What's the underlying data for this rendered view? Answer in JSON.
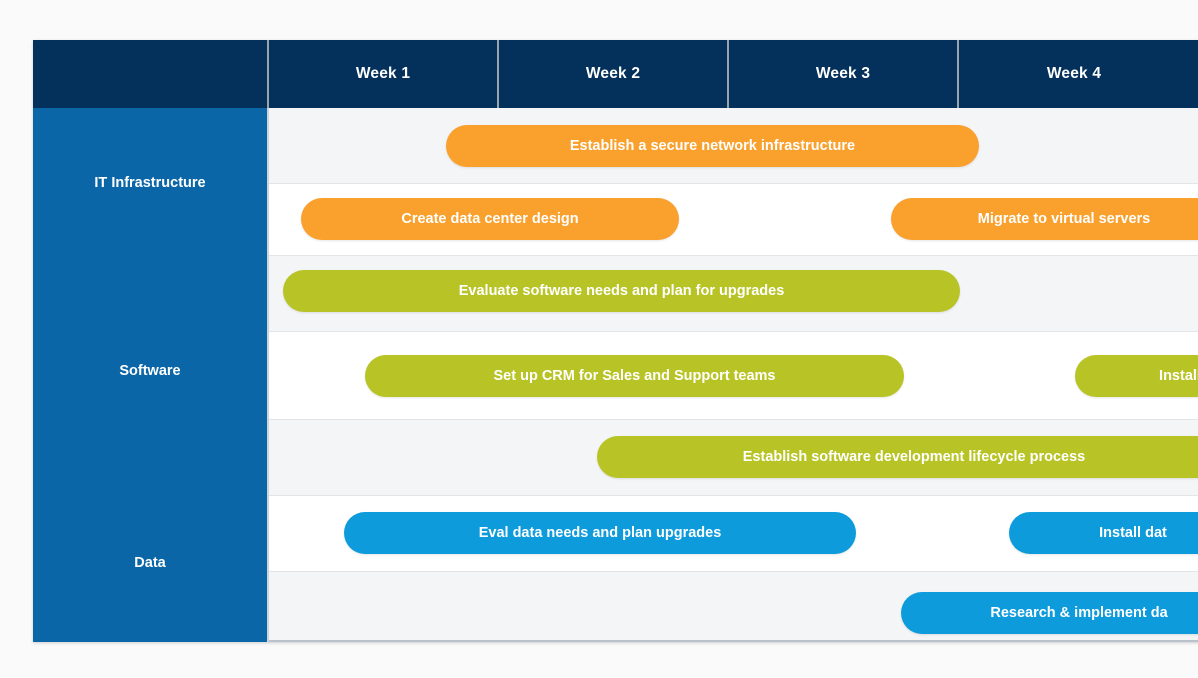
{
  "chart_data": {
    "type": "bar",
    "chart_kind": "gantt",
    "title": "",
    "xlabel": "",
    "ylabel": "",
    "columns": [
      "Week 1",
      "Week 2",
      "Week 3",
      "Week 4"
    ],
    "axis_range_weeks": [
      1,
      5
    ],
    "categories": [
      "IT Infrastructure",
      "Software",
      "Data"
    ],
    "colors": {
      "header_background": "#04305C",
      "category_column": "#0B66A8",
      "row_gray": "#F4F5F6",
      "row_white": "#FFFFFF",
      "orange": "#F9A02D",
      "green": "#B8C425",
      "blue": "#0E9BDC",
      "grid_line": "#E2E4E6",
      "page_background": "#FAFAFA",
      "bar_text": "#FFFFFF"
    },
    "tasks": [
      {
        "label": "Establish a secure network infrastructure",
        "category": "IT Infrastructure",
        "row": 0,
        "color": "#F9A02D",
        "start_week": 1.77,
        "end_week": 4.09,
        "clipped_right": false
      },
      {
        "label": "Create data center design",
        "category": "IT Infrastructure",
        "row": 1,
        "color": "#F9A02D",
        "start_week": 1.14,
        "end_week": 2.78,
        "clipped_right": false
      },
      {
        "label": "Migrate to virtual servers",
        "category": "IT Infrastructure",
        "row": 1,
        "color": "#F9A02D",
        "start_week": 3.7,
        "end_week": 5.2,
        "clipped_right": true
      },
      {
        "label": "Evaluate software needs and plan for upgrades",
        "category": "Software",
        "row": 2,
        "color": "#B8C425",
        "start_week": 1.06,
        "end_week": 4.0,
        "clipped_right": false
      },
      {
        "label": "Set up CRM for Sales and Support teams",
        "category": "Software",
        "row": 3,
        "color": "#B8C425",
        "start_week": 1.42,
        "end_week": 3.76,
        "clipped_right": false
      },
      {
        "label": "Install",
        "category": "Software",
        "row": 3,
        "color": "#B8C425",
        "start_week": 4.49,
        "end_week": 5.4,
        "clipped_right": true
      },
      {
        "label": "Establish software development lifecycle process",
        "category": "Software",
        "row": 4,
        "color": "#B8C425",
        "start_week": 2.43,
        "end_week": 5.3,
        "clipped_right": true
      },
      {
        "label": "Eval data needs and plan upgrades",
        "category": "Data",
        "row": 5,
        "color": "#0E9BDC",
        "start_week": 1.33,
        "end_week": 3.55,
        "clipped_right": false
      },
      {
        "label": "Install dat",
        "category": "Data",
        "row": 5,
        "color": "#0E9BDC",
        "start_week": 4.22,
        "end_week": 5.3,
        "clipped_right": true
      },
      {
        "label": "Research & implement da",
        "category": "Data",
        "row": 6,
        "color": "#0E9BDC",
        "start_week": 3.75,
        "end_week": 5.3,
        "clipped_right": true
      }
    ]
  },
  "header": {
    "corner_label": "",
    "weeks": [
      {
        "label": "Week 1"
      },
      {
        "label": "Week 2"
      },
      {
        "label": "Week 3"
      },
      {
        "label": "Week 4"
      }
    ]
  },
  "categories": [
    {
      "label": "IT Infrastructure"
    },
    {
      "label": "Software"
    },
    {
      "label": "Data"
    }
  ],
  "bars": [
    {
      "label": "Establish a secure network infrastructure"
    },
    {
      "label": "Create data center design"
    },
    {
      "label": "Migrate to virtual servers"
    },
    {
      "label": "Evaluate software needs and plan for upgrades"
    },
    {
      "label": "Set up CRM for Sales and Support teams"
    },
    {
      "label": "Install"
    },
    {
      "label": "Establish software development lifecycle process"
    },
    {
      "label": "Eval data needs and plan upgrades"
    },
    {
      "label": "Install dat"
    },
    {
      "label": "Research & implement da"
    }
  ]
}
